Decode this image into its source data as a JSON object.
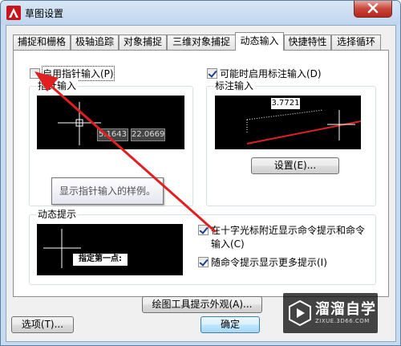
{
  "window": {
    "title": "草图设置"
  },
  "tabs": [
    {
      "label": "捕捉和栅格"
    },
    {
      "label": "极轴追踪"
    },
    {
      "label": "对象捕捉"
    },
    {
      "label": "三维对象捕捉"
    },
    {
      "label": "动态输入"
    },
    {
      "label": "快捷特性"
    },
    {
      "label": "选择循环"
    }
  ],
  "pointer_input": {
    "checkbox_label": "启用指针输入(P)",
    "checked": false,
    "group_title": "指针输入",
    "coord_x": "5.1643",
    "coord_y": "22.0669",
    "tooltip": "显示指针输入的样例。"
  },
  "dimension_input": {
    "checkbox_label": "可能时启用标注输入(D)",
    "checked": true,
    "group_title": "标注输入",
    "dim_value": "3.7721",
    "settings_button": "设置(E)..."
  },
  "dynamic_prompts": {
    "group_title": "动态提示",
    "preview_text": "指定第一点:",
    "opt1_label_line1": "在十字光标附近显示命令提示和命令",
    "opt1_label_line2": "输入(C)",
    "opt1_checked": true,
    "opt2_label": "随命令提示显示更多提示(I)",
    "opt2_checked": true
  },
  "appearance_button": "绘图工具提示外观(A)...",
  "footer": {
    "options_button": "选项(T)...",
    "ok_button": "确定"
  },
  "watermark": {
    "text": "溜溜自学",
    "sub": "ZIXUE.3D66.COM"
  },
  "colors": {
    "accent_red": "#e02020",
    "preview_bg": "#000000",
    "close_red": "#c7443a"
  }
}
